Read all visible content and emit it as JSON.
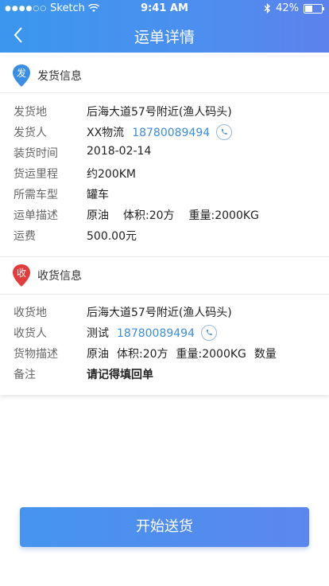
{
  "status_bar": {
    "signal": "●●●●○○",
    "carrier": "Sketch",
    "time": "9:41 AM",
    "battery": "42%",
    "icons": [
      "wifi-icon",
      "bluetooth-icon",
      "battery-icon"
    ]
  },
  "nav": {
    "title": "运单详情",
    "back_icon": "chevron-left-icon"
  },
  "ship_section": {
    "pin_text": "发",
    "pin_color": "#3b8ee5",
    "title": "发货信息",
    "rows": [
      {
        "key": "发货地",
        "value": "后海大道57号附近(渔人码头)"
      },
      {
        "key": "发货人",
        "value": "XX物流",
        "phone": "18780089494"
      },
      {
        "key": "装货时间",
        "value": "2018-02-14"
      },
      {
        "key": "货运里程",
        "value": "约200KM"
      },
      {
        "key": "所需车型",
        "value": "罐车"
      },
      {
        "key": "运单描述",
        "parts": [
          "原油",
          "体积:20方",
          "重量:2000KG"
        ]
      },
      {
        "key": "运费",
        "value": "500.00元"
      }
    ]
  },
  "receive_section": {
    "pin_text": "收",
    "pin_color": "#e23c3c",
    "title": "收货信息",
    "rows": [
      {
        "key": "收货地",
        "value": "后海大道57号附近(渔人码头)"
      },
      {
        "key": "收货人",
        "value": "测试",
        "phone": "18780089494"
      },
      {
        "key": "货物描述",
        "parts": [
          "原油",
          "体积:20方",
          "重量:2000KG",
          "数量"
        ]
      },
      {
        "key": "备注",
        "value": "请记得填回单"
      }
    ]
  },
  "colors": {
    "accent": "#4a92ee",
    "highlight_red": "#e0383b",
    "fee_orange": "#f5a623"
  },
  "action": {
    "start_label": "开始送货"
  }
}
